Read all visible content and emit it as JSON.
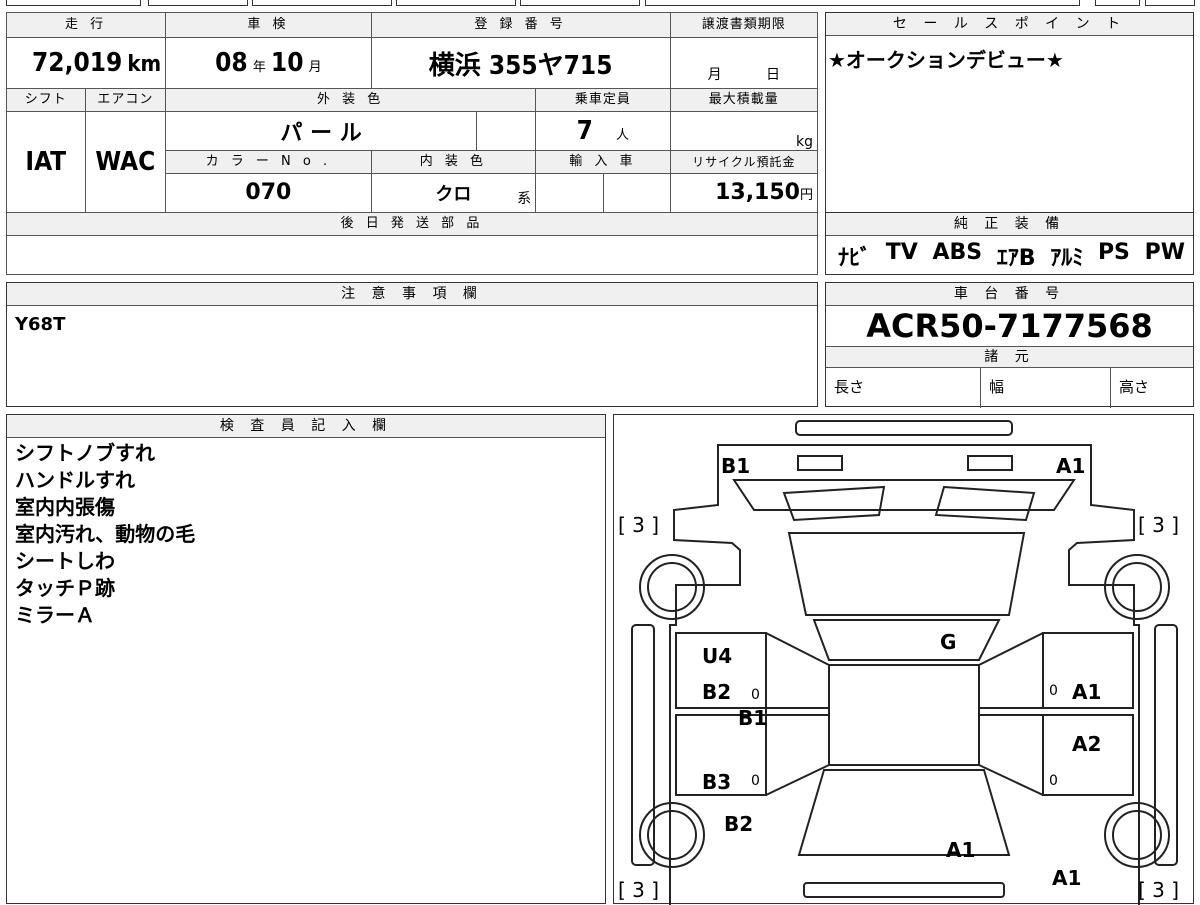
{
  "vehicle": {
    "mileage_header": "走 行",
    "mileage": "72,019",
    "mileage_unit": "km",
    "inspection_header": "車 検",
    "inspection_year": "08",
    "inspection_year_unit": "年",
    "inspection_month": "10",
    "inspection_month_unit": "月",
    "registration_header": "登 録 番 号",
    "registration_number": "横浜 355ヤ715",
    "transfer_deadline_header": "譲渡書類期限",
    "transfer_month_unit": "月",
    "transfer_day_unit": "日",
    "shift_header": "シフト",
    "shift": "IAT",
    "aircon_header": "エアコン",
    "aircon": "WAC",
    "exterior_color_header": "外 装 色",
    "exterior_color": "パ ー ル",
    "capacity_header": "乗車定員",
    "capacity": "7",
    "capacity_unit": "人",
    "max_load_header": "最大積載量",
    "max_load_unit": "kg",
    "color_no_header": "カ ラ ー  N o .",
    "color_no": "070",
    "interior_color_header": "内 装 色",
    "interior_color": "クロ",
    "interior_color_suffix": "系",
    "import_header": "輸 入 車",
    "recycle_fee_header": "リサイクル預託金",
    "recycle_fee": "13,150",
    "recycle_fee_unit": "円",
    "later_parts_header": "後 日 発 送 部 品"
  },
  "sales_point": {
    "header": "セ ー ル ス ポ イ ン ト",
    "text": "★オークションデビュー★"
  },
  "genuine_equipment": {
    "header": "純 正 装 備",
    "items": [
      "ﾅﾋﾞ",
      "TV",
      "ABS",
      "ｴｱB",
      "ｱﾙﾐ",
      "PS",
      "PW"
    ]
  },
  "notes": {
    "header": "注 意 事 項 欄",
    "text": "Y68T"
  },
  "chassis": {
    "header": "車 台 番 号",
    "number": "ACR50-7177568",
    "specs_header": "諸 元",
    "length_label": "長さ",
    "width_label": "幅",
    "height_label": "高さ"
  },
  "inspector": {
    "header": "検 査 員 記 入 欄",
    "lines": [
      "シフトノブすれ",
      "ハンドルすれ",
      "室内内張傷",
      "室内汚れ、動物の毛",
      "シートしわ",
      "タッチＰ跡",
      "ミラーＡ"
    ]
  },
  "diagram": {
    "labels": {
      "front_left": "B1",
      "front_right": "A1",
      "tire_fl": "[ 3 ]",
      "tire_fr": "[ 3 ]",
      "tire_rl": "[ 3 ]",
      "tire_rr": "[ 3 ]",
      "roof": "G",
      "left_front_door_upper": "U4",
      "left_front_door": "B2",
      "left_sill": "B1",
      "left_rear_door": "B3",
      "left_rear_quarter": "B2",
      "right_front_door": "A1",
      "right_rear_door": "A2",
      "rear_center": "A1",
      "rear_right": "A1",
      "zero": "0"
    }
  }
}
